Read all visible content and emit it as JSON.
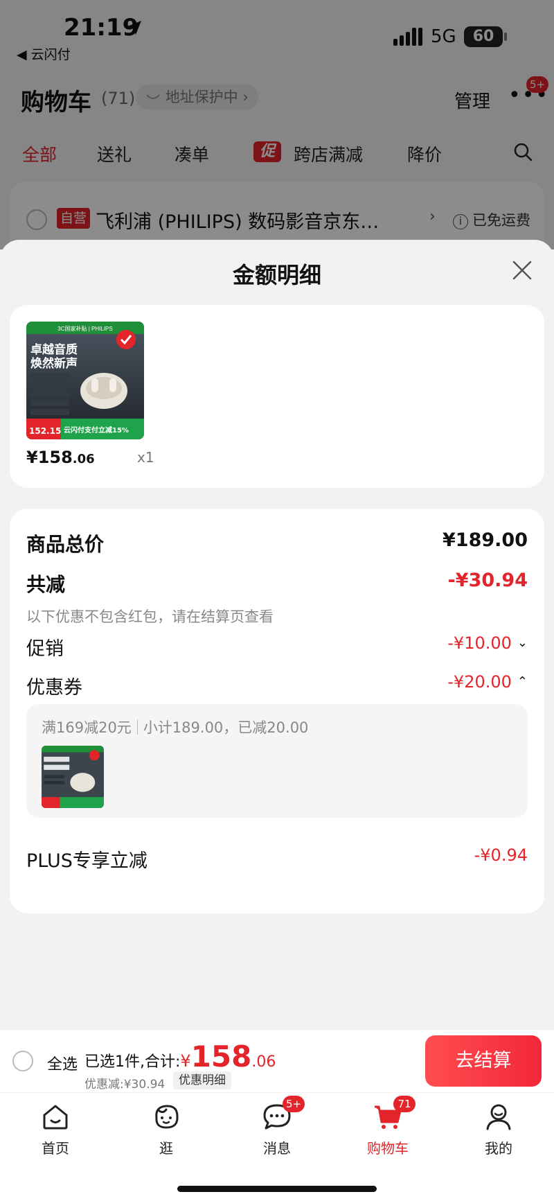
{
  "status_bar": {
    "time": "21:19",
    "back_app": "◀ 云闪付",
    "network": "5G",
    "battery": "60"
  },
  "cart_header": {
    "title": "购物车",
    "count": "(71)",
    "address_protect": "地址保护中 ›",
    "manage_label": "管理",
    "more_badge": "5+"
  },
  "tabs": [
    {
      "label": "全部",
      "active": true
    },
    {
      "label": "送礼",
      "active": false
    },
    {
      "label": "凑单",
      "active": false
    },
    {
      "label": "跨店满减",
      "active": false
    },
    {
      "label": "降价",
      "active": false
    }
  ],
  "promo_tag": "促",
  "shop": {
    "tag": "自营",
    "name": "飞利浦 (PHILIPS) 数码影音京东…",
    "chevron": "›",
    "shipping": "已免运费",
    "info_glyph": "i"
  },
  "sheet": {
    "title": "金额明细",
    "product": {
      "price_int": "¥158",
      "price_dec": ".06",
      "qty": "x1",
      "image_texts": {
        "top_banner": "3C国家补贴 | PHILIPS",
        "headline1": "卓越音质",
        "headline2": "焕然新声",
        "price_tag": "152.15",
        "bottom_banner": "云闪付支付立减15%"
      }
    },
    "details": {
      "total_label": "商品总价",
      "total_value": "¥189.00",
      "reduce_label": "共减",
      "reduce_value": "-¥30.94",
      "note": "以下优惠不包含红包，请在结算页查看",
      "promo_label": "促销",
      "promo_value": "-¥10.00",
      "promo_chevron": "⌄",
      "coupon_label": "优惠券",
      "coupon_value": "-¥20.00",
      "coupon_chevron": "⌃",
      "coupon_rule_a": "满169减20元",
      "coupon_rule_b": "小计189.00，已减20.00",
      "plus_label": "PLUS专享立减",
      "plus_value": "-¥0.94"
    }
  },
  "checkout": {
    "select_all": "全选",
    "selected_text": "已选1件,合计:",
    "total_yen": "¥",
    "total_int": "158",
    "total_dec": ".06",
    "discount_text": "优惠减:¥30.94",
    "detail_chip": "优惠明细",
    "button": "去结算"
  },
  "tabbar": [
    {
      "label": "首页",
      "icon": "home-icon"
    },
    {
      "label": "逛",
      "icon": "browse-icon"
    },
    {
      "label": "消息",
      "icon": "message-icon",
      "badge": "5+"
    },
    {
      "label": "购物车",
      "icon": "cart-icon",
      "badge": "71",
      "active": true
    },
    {
      "label": "我的",
      "icon": "profile-icon"
    }
  ],
  "colors": {
    "accent": "#e3242b",
    "overlay": "rgba(0,0,0,0.45)"
  }
}
